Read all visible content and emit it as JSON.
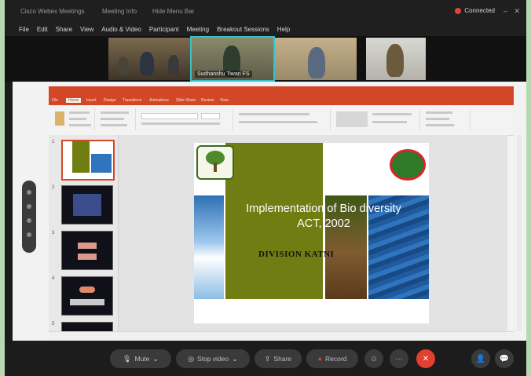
{
  "titlebar": {
    "tab1": "Cisco Webex Meetings",
    "tab2": "Meeting Info",
    "tab3": "Hide Menu Bar",
    "connected": "Connected"
  },
  "menu": [
    "File",
    "Edit",
    "Share",
    "View",
    "Audio & Video",
    "Participant",
    "Meeting",
    "Breakout Sessions",
    "Help"
  ],
  "videos": [
    {
      "name": ""
    },
    {
      "name": "Sudhanshu Tiwari FS"
    },
    {
      "name": ""
    },
    {
      "name": ""
    }
  ],
  "ppt": {
    "tabs": [
      "File",
      "Home",
      "Insert",
      "Design",
      "Transitions",
      "Animations",
      "Slide Show",
      "Review",
      "View"
    ],
    "active_tab": "Home",
    "slide_numbers": [
      "1",
      "2",
      "3",
      "4",
      "5"
    ]
  },
  "slide": {
    "title": "Implementation of Bio diversity ACT, 2002",
    "subtitle": "DIVISION KATNI"
  },
  "controls": {
    "mute": "Mute",
    "stop_video": "Stop video",
    "share": "Share",
    "record": "Record"
  },
  "colors": {
    "accent_ppt": "#d24726",
    "end_call": "#e1402f",
    "slide_green": "#6f7d12"
  }
}
